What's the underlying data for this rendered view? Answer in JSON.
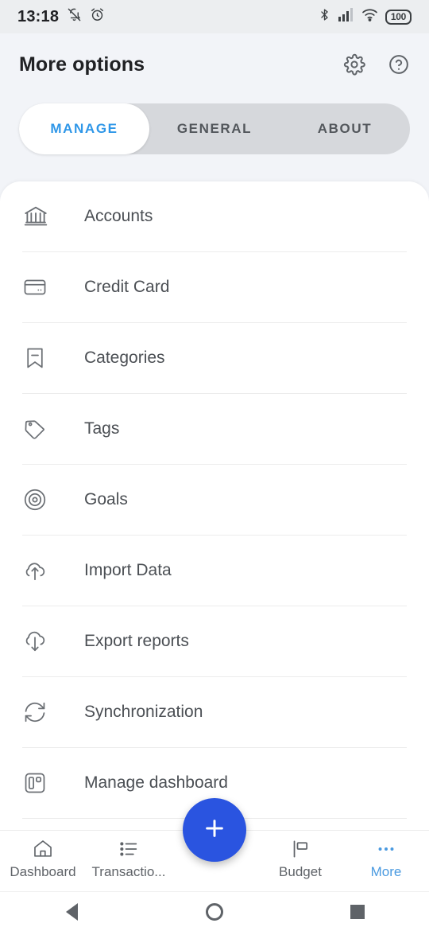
{
  "status_bar": {
    "time": "13:18",
    "battery_level": "100",
    "icons": [
      "bell-muted-icon",
      "alarm-clock-icon",
      "bluetooth-icon",
      "cellular-signal-icon",
      "wifi-icon",
      "battery-icon"
    ]
  },
  "header": {
    "title": "More options",
    "settings_icon": "gear-icon",
    "help_icon": "help-circle-icon"
  },
  "tabs": [
    {
      "label": "MANAGE",
      "active": true
    },
    {
      "label": "GENERAL",
      "active": false
    },
    {
      "label": "ABOUT",
      "active": false
    }
  ],
  "menu_items": [
    {
      "label": "Accounts",
      "icon": "bank-icon"
    },
    {
      "label": "Credit Card",
      "icon": "credit-card-icon"
    },
    {
      "label": "Categories",
      "icon": "bookmark-minus-icon"
    },
    {
      "label": "Tags",
      "icon": "tag-icon"
    },
    {
      "label": "Goals",
      "icon": "target-icon"
    },
    {
      "label": "Import Data",
      "icon": "cloud-upload-icon"
    },
    {
      "label": "Export reports",
      "icon": "cloud-download-icon"
    },
    {
      "label": "Synchronization",
      "icon": "sync-refresh-icon"
    },
    {
      "label": "Manage dashboard",
      "icon": "dashboard-layout-icon"
    }
  ],
  "bottom_nav": {
    "items": [
      {
        "label": "Dashboard",
        "icon": "home-icon",
        "active": false
      },
      {
        "label": "Transactio...",
        "icon": "list-icon",
        "active": false
      },
      {
        "label": "Budget",
        "icon": "flag-icon",
        "active": false
      },
      {
        "label": "More",
        "icon": "ellipsis-icon",
        "active": true
      }
    ],
    "fab_icon": "plus-icon"
  },
  "system_nav": {
    "back": "back-triangle-icon",
    "home": "home-circle-icon",
    "recents": "recents-square-icon"
  },
  "colors": {
    "accent_blue": "#2f97e8",
    "fab_blue": "#2a54e0",
    "nav_active": "#4a9ae0",
    "page_bg": "#f2f4f8"
  }
}
